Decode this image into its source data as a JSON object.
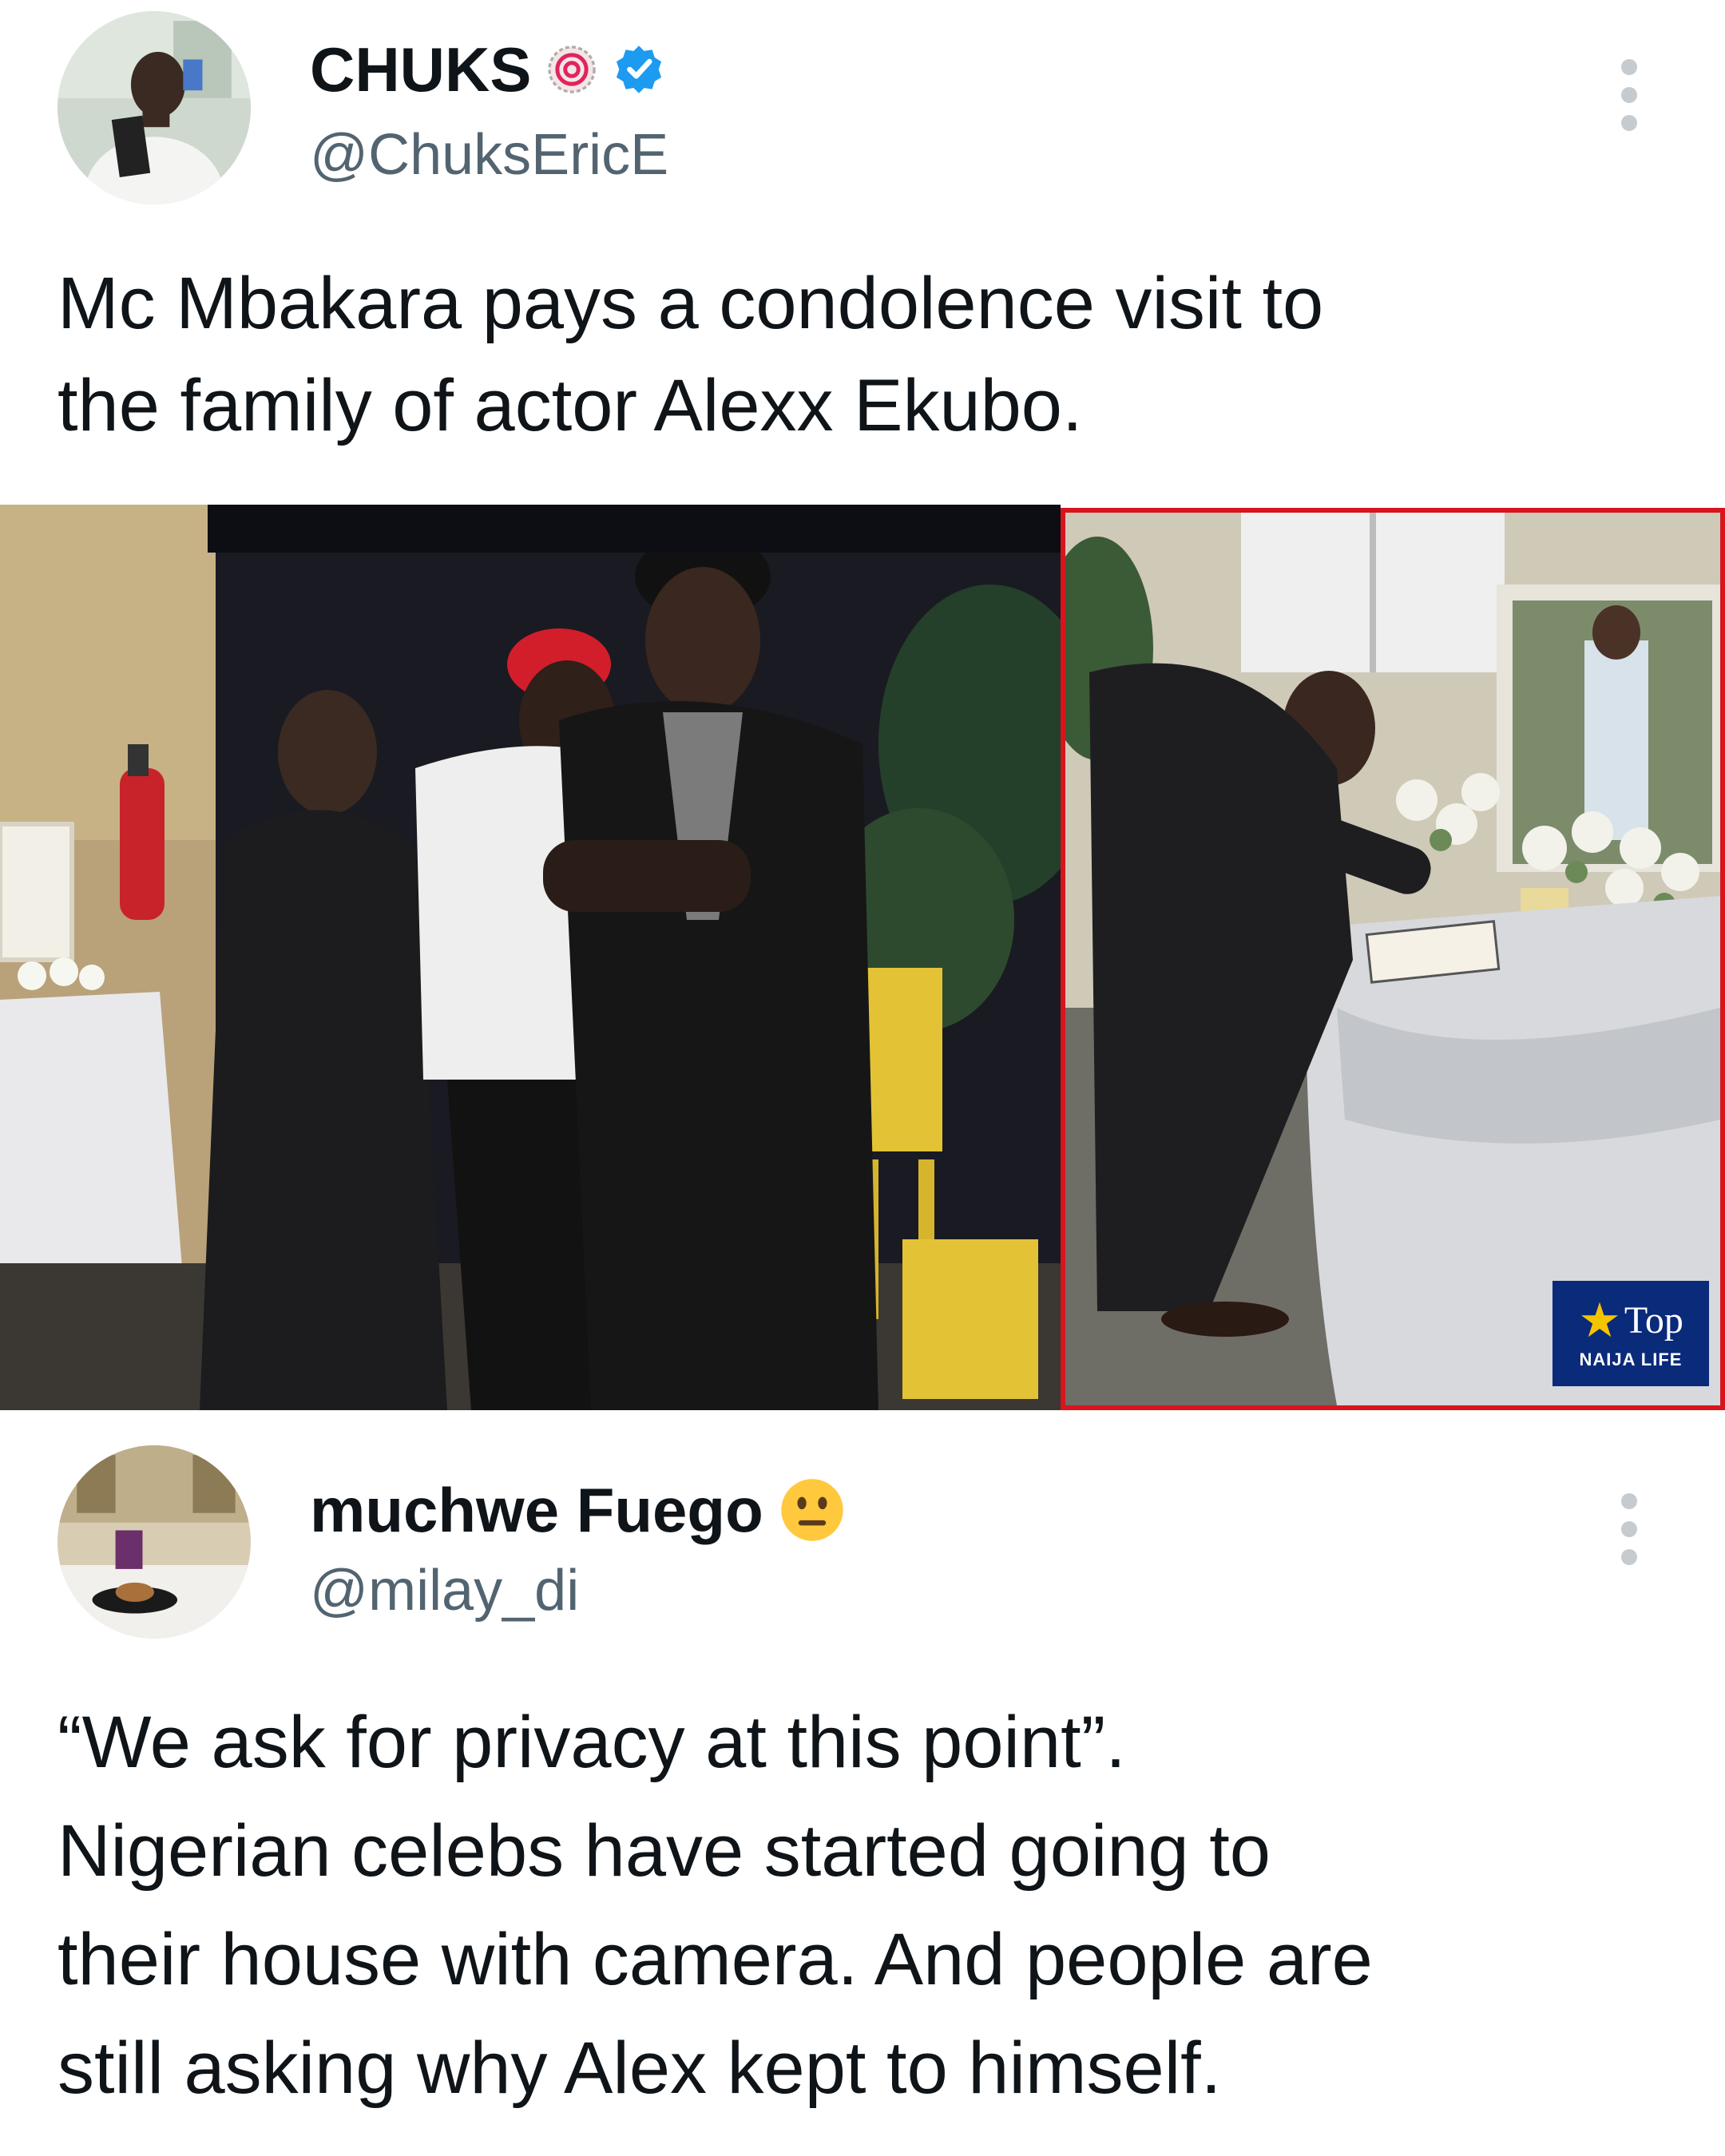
{
  "tweet1": {
    "display_name": "CHUKS",
    "handle": "@ChuksEricE",
    "text_lines": [
      "Mc Mbakara pays a condolence visit to",
      "the family of actor Alexx Ekubo."
    ],
    "badges": [
      "spiral-badge-icon",
      "verified-badge-icon"
    ]
  },
  "media": {
    "watermark": {
      "line1": "Top",
      "line2": "NAIJA LIFE"
    },
    "accent_border_color": "#d8141c"
  },
  "tweet2": {
    "display_name": "muchwe Fuego",
    "handle": "@milay_di",
    "emoji": "neutral-face-emoji",
    "text_lines": [
      "“We ask for privacy at this point”.",
      "Nigerian celebs have started going to",
      "their house with camera. And people are",
      "still asking why Alex kept to himself."
    ]
  },
  "colors": {
    "text_primary": "#0f1419",
    "text_secondary": "#536471",
    "verified_blue": "#1d9bf0"
  }
}
